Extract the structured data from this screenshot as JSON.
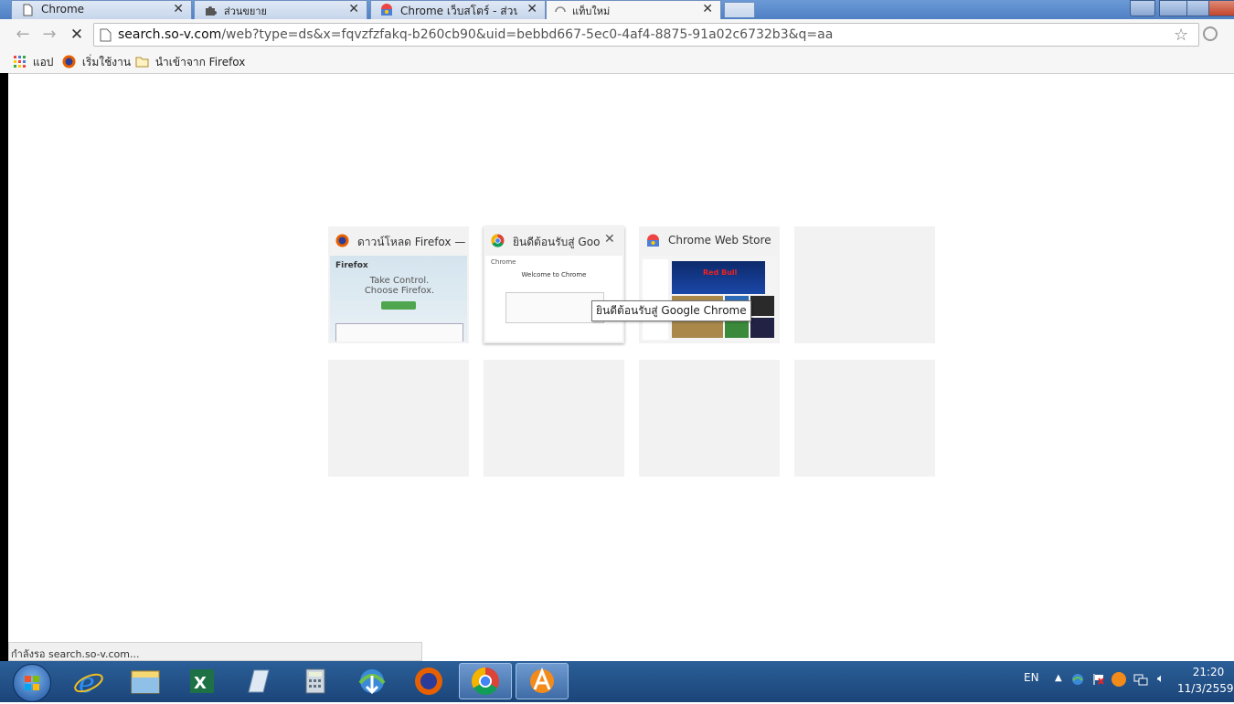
{
  "tabs": [
    {
      "label": "Chrome",
      "icon": "page-icon"
    },
    {
      "label": "ส่วนขยาย",
      "icon": "puzzle-icon"
    },
    {
      "label": "Chrome เว็บสโตร์ - ส่วนขยาย",
      "icon": "webstore-icon"
    },
    {
      "label": "แท็บใหม่",
      "icon": "loading-icon"
    }
  ],
  "toolbar": {
    "url_host": "search.so-v.com",
    "url_path": "/web?type=ds&x=fqvzfzfakq-b260cb90&uid=bebbd667-5ec0-4af4-8875-91a02c6732b3&q=aa"
  },
  "bookmarks": [
    {
      "label": "แอป",
      "icon": "apps-grid-icon"
    },
    {
      "label": "เริ่มใช้งาน",
      "icon": "firefox-icon"
    },
    {
      "label": "นำเข้าจาก Firefox",
      "icon": "folder-icon"
    }
  ],
  "most_visited": [
    {
      "title": "ดาวน์โหลด Firefox — เ",
      "icon": "firefox-icon",
      "shot_brand": "Firefox",
      "shot_headline": "Take Control. Choose Firefox."
    },
    {
      "title": "ยินดีต้อนรับสู่ Goog",
      "icon": "chrome-icon",
      "shot_brand": "Chrome",
      "shot_headline": "Welcome to Chrome"
    },
    {
      "title": "Chrome Web Store",
      "icon": "webstore-icon",
      "shot_brand": "Red Bull",
      "shot_headline": ""
    }
  ],
  "tooltip": "ยินดีต้อนรับสู่ Google Chrome",
  "status": "กำลังรอ search.so-v.com...",
  "tray": {
    "lang": "EN",
    "time": "21:20",
    "date": "11/3/2559"
  }
}
